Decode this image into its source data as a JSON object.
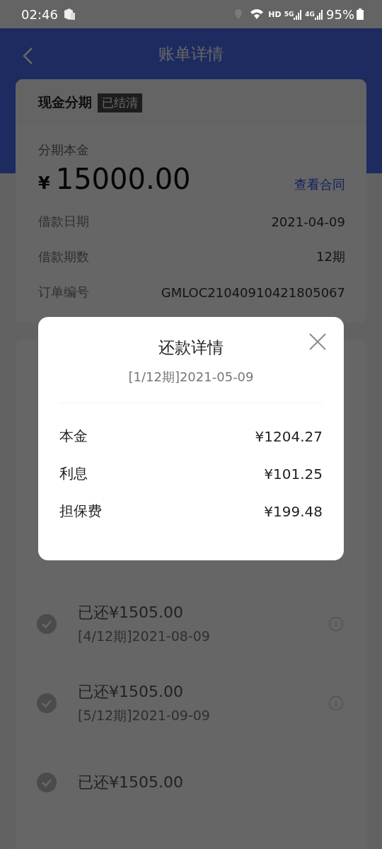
{
  "status_bar": {
    "time": "02:46",
    "hd": "HD",
    "net_1": "5G",
    "net_2": "4G",
    "battery": "95%"
  },
  "header": {
    "title": "账单详情"
  },
  "loan_card": {
    "title": "现金分期",
    "tag": "已结清",
    "principal_label": "分期本金",
    "currency": "¥",
    "principal": "15000.00",
    "contract_link": "查看合同",
    "fields": [
      {
        "label": "借款日期",
        "value": "2021-04-09"
      },
      {
        "label": "借款期数",
        "value": "12期"
      },
      {
        "label": "订单编号",
        "value": "GMLOC21040910421805067"
      }
    ]
  },
  "installments": [
    {
      "amount": "已还¥1505.00",
      "date": "[4/12期]2021-08-09"
    },
    {
      "amount": "已还¥1505.00",
      "date": "[5/12期]2021-09-09"
    },
    {
      "amount": "已还¥1505.00"
    }
  ],
  "dialog": {
    "title": "还款详情",
    "subtitle": "[1/12期]2021-05-09",
    "rows": [
      {
        "label": "本金",
        "value": "¥1204.27"
      },
      {
        "label": "利息",
        "value": "¥101.25"
      },
      {
        "label": "担保费",
        "value": "¥199.48"
      }
    ]
  }
}
